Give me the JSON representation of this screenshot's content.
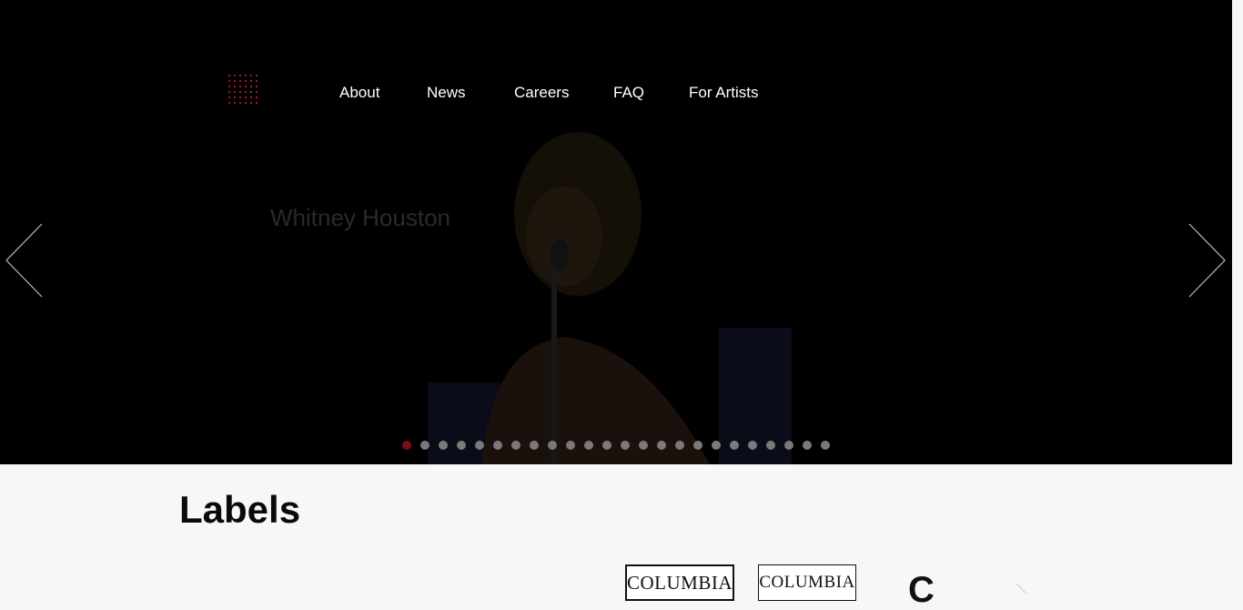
{
  "nav": {
    "items": [
      {
        "label": "About"
      },
      {
        "label": "News"
      },
      {
        "label": "Careers"
      },
      {
        "label": "FAQ"
      },
      {
        "label": "For Artists"
      }
    ]
  },
  "hero": {
    "slide_title": "Whitney Houston",
    "slide_count": 24,
    "active_slide": 1
  },
  "labels": {
    "heading": "Labels",
    "logos": [
      {
        "text": "COLUMBIA"
      },
      {
        "text": "COLUMBIA"
      },
      {
        "text": "C"
      }
    ]
  },
  "colors": {
    "logo_accent": "#e0202a",
    "active_dot": "#7a1015",
    "hero_background": "#000000",
    "page_background": "#f7f7f7"
  },
  "icons": {
    "logo": "dot-grid-logo",
    "prev": "chevron-left-icon",
    "next": "chevron-right-icon"
  }
}
